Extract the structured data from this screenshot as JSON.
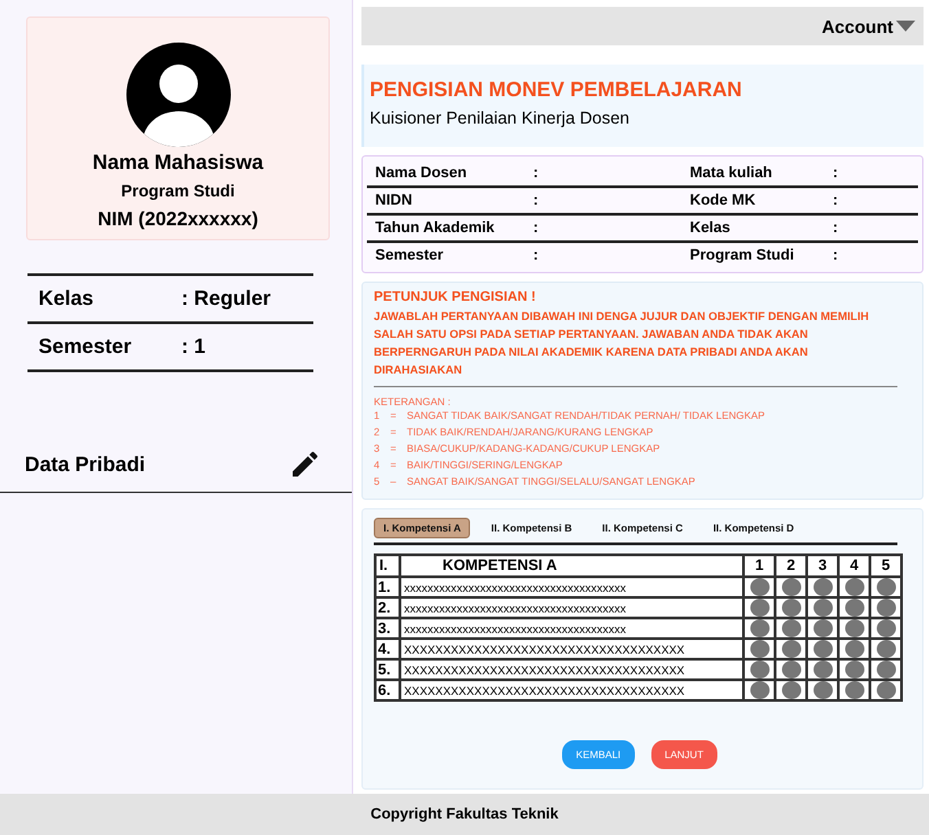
{
  "topbar": {
    "account": "Account"
  },
  "sidebar": {
    "name": "Nama Mahasiswa",
    "program": "Program Studi",
    "nim": "NIM (2022xxxxxx)",
    "info": [
      {
        "label": "Kelas",
        "value": ": Reguler"
      },
      {
        "label": "Semester",
        "value": ": 1"
      }
    ],
    "personal_data": "Data Pribadi"
  },
  "header": {
    "title": "PENGISIAN MONEV PEMBELAJARAN",
    "subtitle": "Kuisioner Penilaian Kinerja Dosen"
  },
  "lecturer_info": [
    {
      "left_label": "Nama Dosen",
      "left_sep": ":",
      "right_label": "Mata kuliah",
      "right_sep": ":"
    },
    {
      "left_label": "NIDN",
      "left_sep": ":",
      "right_label": "Kode MK",
      "right_sep": ":"
    },
    {
      "left_label": "Tahun Akademik",
      "left_sep": ":",
      "right_label": "Kelas",
      "right_sep": ":"
    },
    {
      "left_label": "Semester",
      "left_sep": ":",
      "right_label": "Program Studi",
      "right_sep": ":"
    }
  ],
  "instructions": {
    "title": "PETUNJUK PENGISIAN !",
    "body": "JAWABLAH PERTANYAAN DIBAWAH INI DENGA JUJUR DAN OBJEKTIF DENGAN MEMILIH SALAH SATU OPSI PADA SETIAP PERTANYAAN. JAWABAN ANDA TIDAK AKAN BERPERNGARUH PADA NILAI AKADEMIK KARENA DATA PRIBADI ANDA AKAN DIRAHASIAKAN",
    "legend_title": "KETERANGAN :",
    "legend": [
      {
        "num": "1",
        "sep": "=",
        "text": "SANGAT TIDAK BAIK/SANGAT RENDAH/TIDAK PERNAH/ TIDAK LENGKAP"
      },
      {
        "num": "2",
        "sep": "=",
        "text": "TIDAK BAIK/RENDAH/JARANG/KURANG LENGKAP"
      },
      {
        "num": "3",
        "sep": "=",
        "text": "BIASA/CUKUP/KADANG-KADANG/CUKUP LENGKAP"
      },
      {
        "num": "4",
        "sep": "=",
        "text": "BAIK/TINGGI/SERING/LENGKAP"
      },
      {
        "num": "5",
        "sep": "–",
        "text": "SANGAT BAIK/SANGAT TINGGI/SELALU/SANGAT LENGKAP"
      }
    ]
  },
  "tabs": [
    {
      "label": "I. Kompetensi A",
      "selected": true
    },
    {
      "label": "II. Kompetensi B",
      "selected": false
    },
    {
      "label": "II. Kompetensi C",
      "selected": false
    },
    {
      "label": "II. Kompetensi D",
      "selected": false
    }
  ],
  "table": {
    "section": "I.",
    "heading": "KOMPETENSI A",
    "columns": [
      "1",
      "2",
      "3",
      "4",
      "5"
    ],
    "rows": [
      {
        "num": "1.",
        "text": "xxxxxxxxxxxxxxxxxxxxxxxxxxxxxxxxxxxxxx"
      },
      {
        "num": "2.",
        "text": "xxxxxxxxxxxxxxxxxxxxxxxxxxxxxxxxxxxxxx"
      },
      {
        "num": "3.",
        "text": "xxxxxxxxxxxxxxxxxxxxxxxxxxxxxxxxxxxxxx"
      },
      {
        "num": "4.",
        "text": "XXXXXXXXXXXXXXXXXXXXXXXXXXXXXXXXXXXX"
      },
      {
        "num": "5.",
        "text": "XXXXXXXXXXXXXXXXXXXXXXXXXXXXXXXXXXXX"
      },
      {
        "num": "6.",
        "text": "XXXXXXXXXXXXXXXXXXXXXXXXXXXXXXXXXXXX"
      }
    ]
  },
  "buttons": {
    "back": "KEMBALI",
    "next": "LANJUT"
  },
  "footer": "Copyright Fakultas Teknik"
}
